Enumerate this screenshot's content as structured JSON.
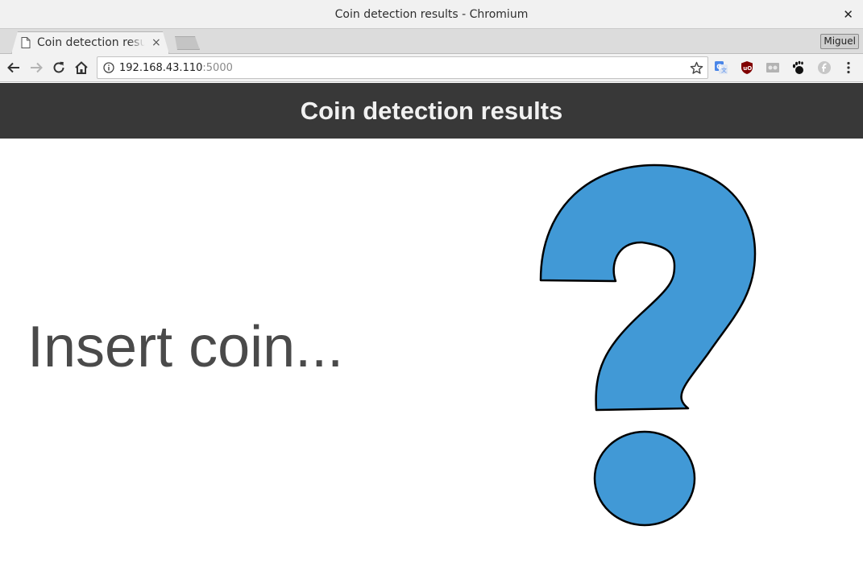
{
  "window": {
    "title": "Coin detection results - Chromium",
    "close_label": "✕"
  },
  "tabs": [
    {
      "label": "Coin detection results",
      "close_label": "×",
      "icon": "page-icon"
    }
  ],
  "profile": {
    "label": "Miguel"
  },
  "omnibox": {
    "host": "192.168.43.110",
    "port": ":5000"
  },
  "extensions": [
    "google-translate-icon",
    "ublock-origin-icon",
    "vr-headset-icon",
    "gnome-foot-icon",
    "fedora-icon"
  ],
  "page": {
    "header_title": "Coin detection results",
    "message": "Insert coin..."
  },
  "colors": {
    "header_bg": "#383838",
    "header_text": "#f1f1f1",
    "message_text": "#4a4a4a",
    "question_fill": "#4199d6",
    "question_stroke": "#000000"
  }
}
